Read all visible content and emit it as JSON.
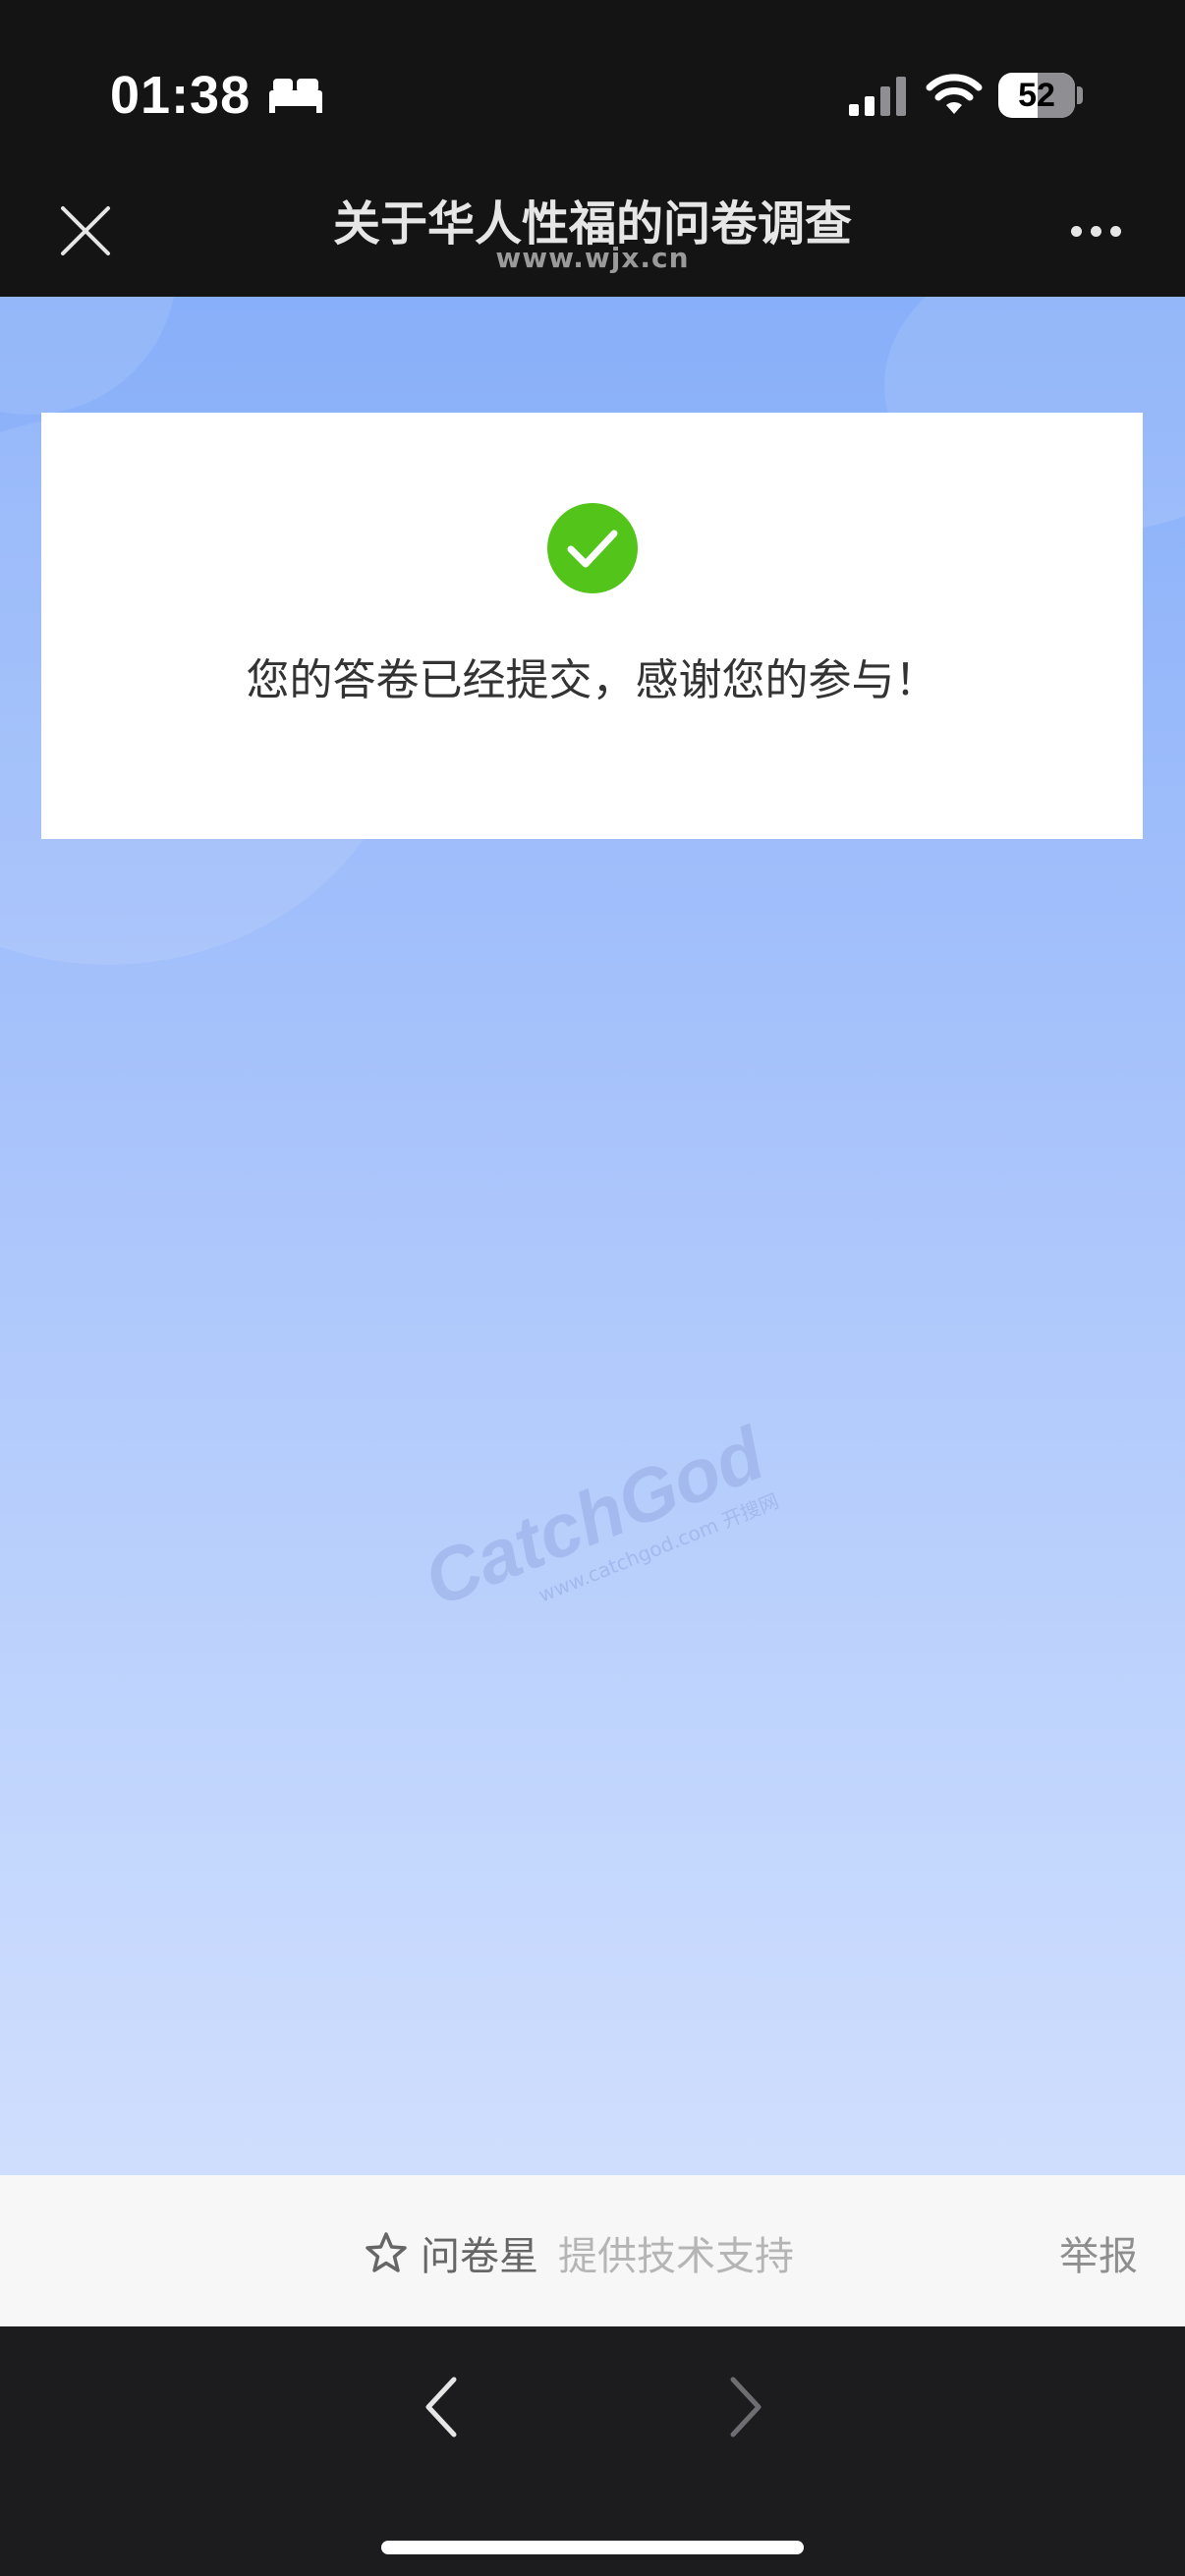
{
  "status_bar": {
    "time": "01:38",
    "battery_level": "52",
    "icons": [
      "sleep-icon",
      "signal-icon",
      "wifi-icon",
      "battery-icon"
    ]
  },
  "header": {
    "title": "关于华人性福的问卷调查",
    "domain": "www.wjx.cn",
    "icons": [
      "close-icon",
      "more-icon"
    ]
  },
  "result": {
    "message": "您的答卷已经提交，感谢您的参与！",
    "icon": "check-circle-icon",
    "icon_color": "#52c41a"
  },
  "watermark": {
    "logo_text": "CatchGod",
    "url_text": "www.catchgod.com 开搜网"
  },
  "footer": {
    "brand": "问卷星",
    "support_text": "提供技术支持",
    "report_label": "举报",
    "icon": "star-icon"
  },
  "bottom_nav": {
    "icons": [
      "back-chevron-icon",
      "forward-chevron-icon"
    ]
  },
  "colors": {
    "bar_background": "#141414",
    "content_gradient_top": "#88aff9",
    "content_gradient_bottom": "#d0defd",
    "success": "#52c41a"
  }
}
